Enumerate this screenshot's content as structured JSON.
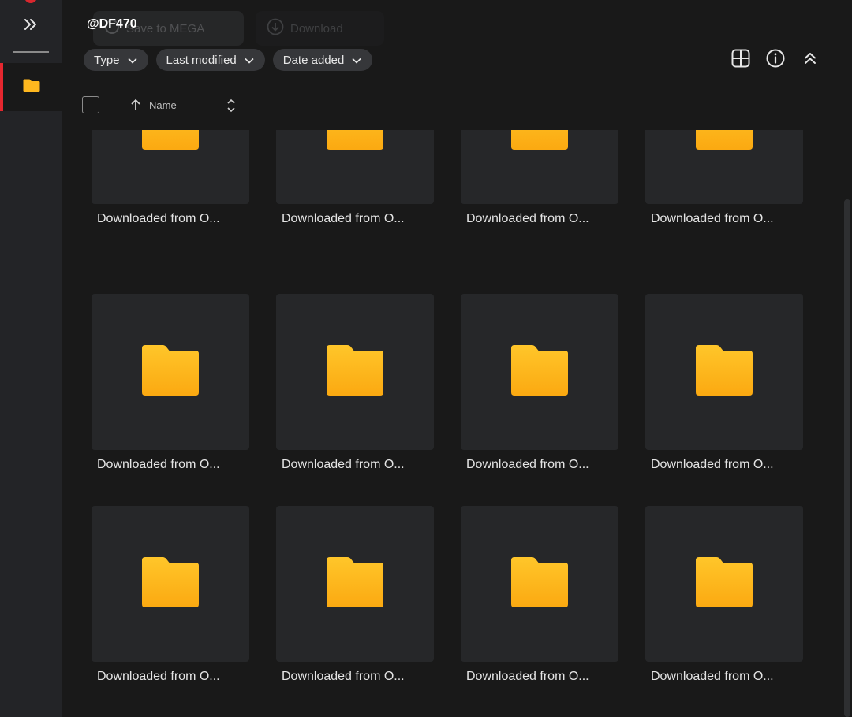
{
  "sidebar": {
    "expand_icon": "chevrons-right-icon",
    "active_nav_icon": "folder-icon",
    "accent_color": "#e5272f"
  },
  "header": {
    "title": "@DF470",
    "save_to_mega_label": "Save to MEGA",
    "download_label": "Download"
  },
  "filters": [
    {
      "label": "Type"
    },
    {
      "label": "Last modified"
    },
    {
      "label": "Date added"
    }
  ],
  "toolbar_icons": [
    "grid-view-icon",
    "info-icon",
    "collapse-up-icon"
  ],
  "list_header": {
    "name_label": "Name",
    "sort_direction": "ascending"
  },
  "folders": [
    {
      "name": "Downloaded from O..."
    },
    {
      "name": "Downloaded from O..."
    },
    {
      "name": "Downloaded from O..."
    },
    {
      "name": "Downloaded from O..."
    },
    {
      "name": "Downloaded from O..."
    },
    {
      "name": "Downloaded from O..."
    },
    {
      "name": "Downloaded from O..."
    },
    {
      "name": "Downloaded from O..."
    },
    {
      "name": "Downloaded from O..."
    },
    {
      "name": "Downloaded from O..."
    },
    {
      "name": "Downloaded from O..."
    },
    {
      "name": "Downloaded from O..."
    }
  ],
  "colors": {
    "background": "#191919",
    "card": "#262729",
    "folder_top": "#ffc62a",
    "folder_bottom": "#fba911"
  }
}
